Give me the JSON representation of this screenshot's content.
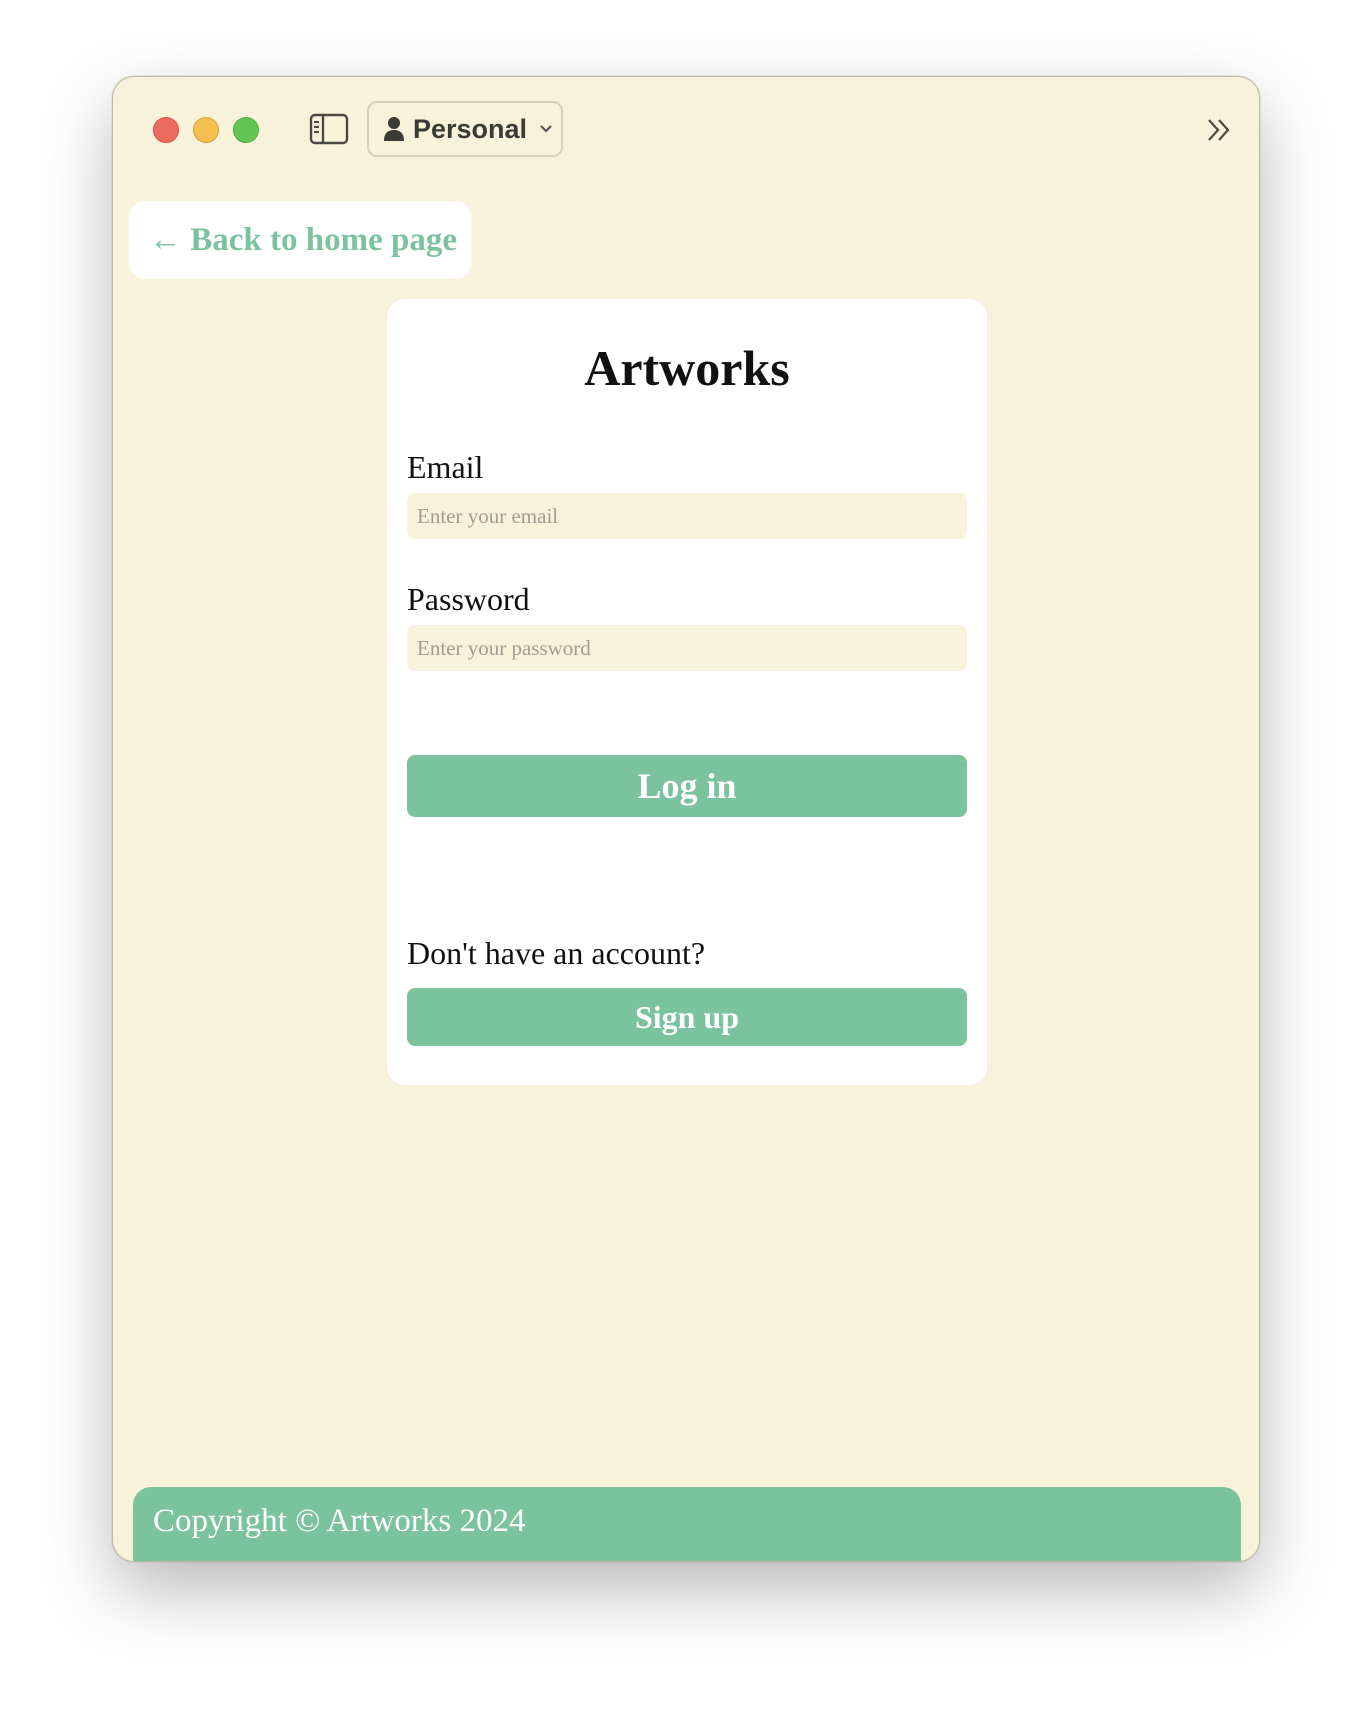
{
  "titlebar": {
    "profile_label": "Personal",
    "icons": [
      "close-icon",
      "minimize-icon",
      "maximize-icon",
      "sidebar-toggle-icon",
      "person-icon",
      "chevron-down-icon",
      "double-chevron-right-icon"
    ]
  },
  "nav": {
    "back_label": "← Back to home page"
  },
  "login": {
    "title": "Artworks",
    "email_label": "Email",
    "email_placeholder": "Enter your email",
    "email_value": "",
    "password_label": "Password",
    "password_placeholder": "Enter your password",
    "password_value": "",
    "login_button": "Log in",
    "signup_prompt": "Don't have an account?",
    "signup_button": "Sign up"
  },
  "footer": {
    "copyright": "Copyright © Artworks 2024"
  },
  "colors": {
    "background": "#f9f2da",
    "accent": "#7bc39d",
    "card": "#ffffff",
    "text": "#111111"
  }
}
